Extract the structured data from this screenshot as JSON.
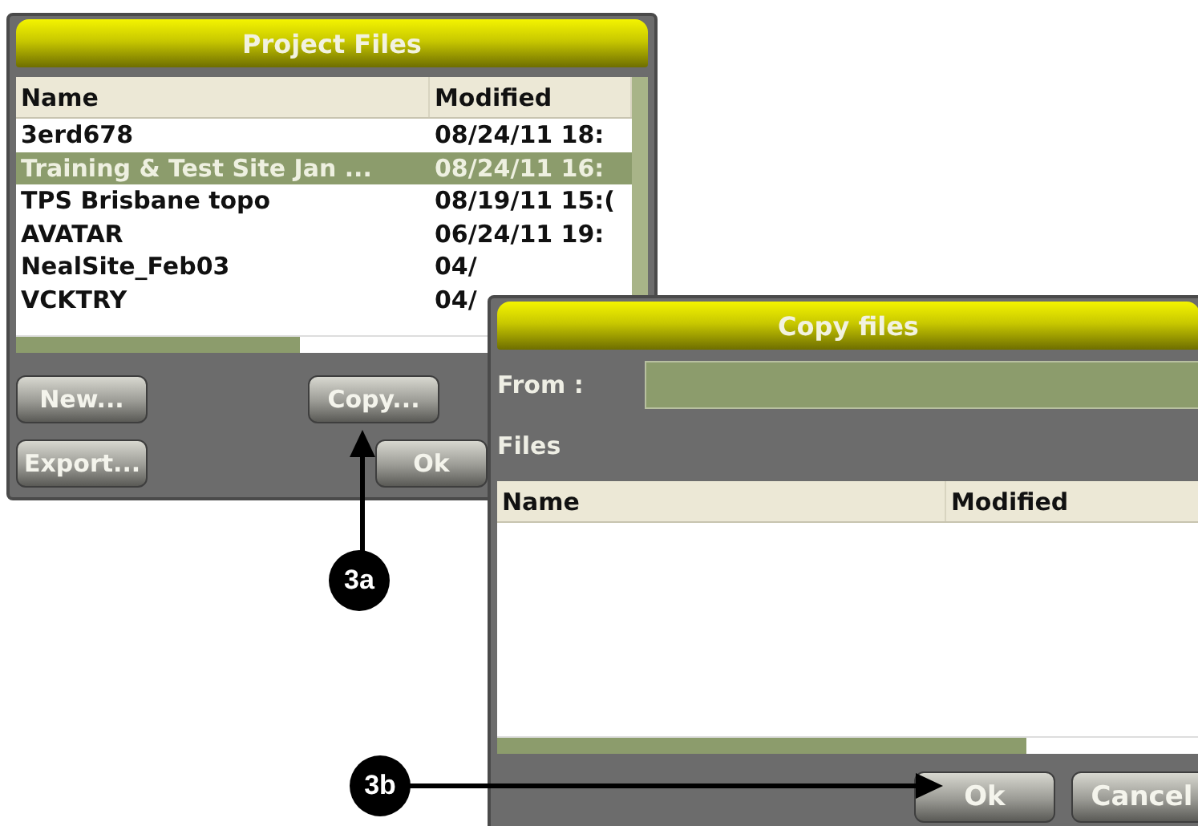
{
  "project_files": {
    "title": "Project Files",
    "columns": [
      "Name",
      "Modified"
    ],
    "rows": [
      {
        "name": "3erd678",
        "modified": "08/24/11 18:",
        "selected": false
      },
      {
        "name": "Training & Test Site Jan ...",
        "modified": "08/24/11 16:",
        "selected": true
      },
      {
        "name": "TPS Brisbane topo",
        "modified": "08/19/11 15:(",
        "selected": false
      },
      {
        "name": "AVATAR",
        "modified": "06/24/11 19:",
        "selected": false
      },
      {
        "name": "NealSite_Feb03",
        "modified": "04/",
        "selected": false
      },
      {
        "name": "VCKTRY",
        "modified": "04/",
        "selected": false
      }
    ],
    "buttons": [
      "New...",
      "Copy...",
      "Export...",
      "Ok"
    ]
  },
  "copy_files": {
    "title": "Copy files",
    "from_label": "From :",
    "files_label": "Files",
    "columns": [
      "Name",
      "Modified"
    ],
    "buttons": [
      "Ok",
      "Cancel"
    ]
  },
  "callouts": [
    {
      "label": "3a"
    },
    {
      "label": "3b"
    }
  ]
}
